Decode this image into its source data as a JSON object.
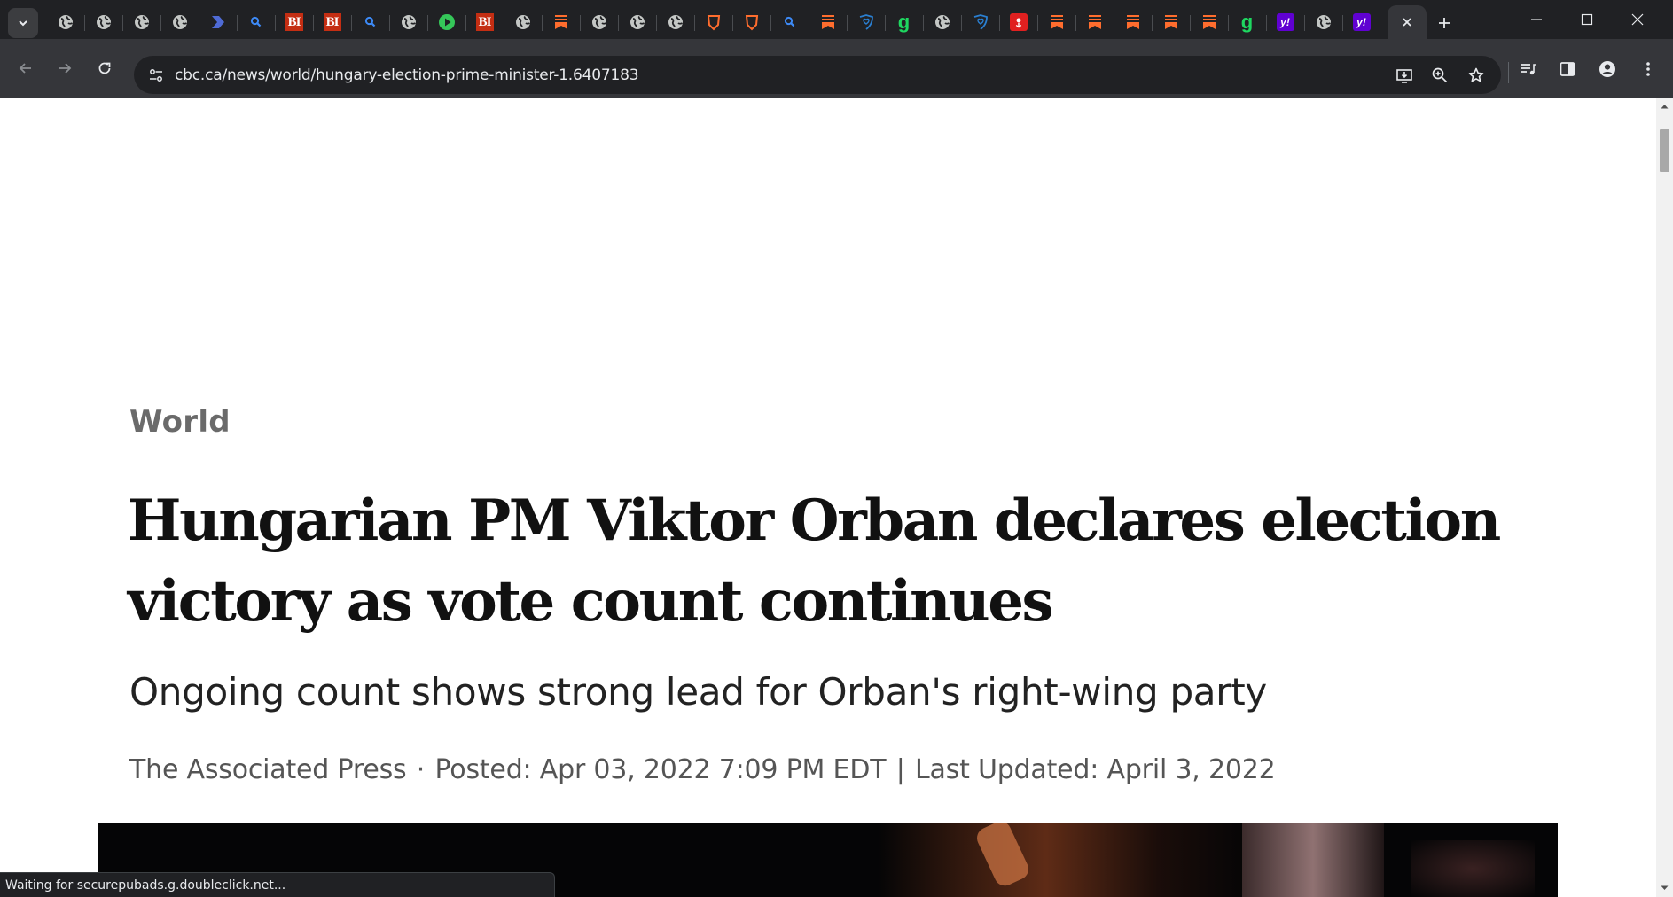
{
  "tabs": [
    {
      "icon": "globe-icon"
    },
    {
      "icon": "globe-icon"
    },
    {
      "icon": "globe-icon"
    },
    {
      "icon": "globe-icon"
    },
    {
      "icon": "blue-arrow-icon"
    },
    {
      "icon": "magnifier-icon"
    },
    {
      "icon": "business-insider-icon",
      "label": "BI"
    },
    {
      "icon": "business-insider-icon",
      "label": "BI"
    },
    {
      "icon": "magnifier-icon"
    },
    {
      "icon": "globe-icon"
    },
    {
      "icon": "play-icon"
    },
    {
      "icon": "business-insider-icon",
      "label": "BI"
    },
    {
      "icon": "globe-icon"
    },
    {
      "icon": "bookmark-ribbon-icon"
    },
    {
      "icon": "globe-icon"
    },
    {
      "icon": "globe-icon"
    },
    {
      "icon": "globe-icon"
    },
    {
      "icon": "brave-shield-icon"
    },
    {
      "icon": "brave-shield-icon"
    },
    {
      "icon": "magnifier-icon"
    },
    {
      "icon": "bookmark-ribbon-icon"
    },
    {
      "icon": "heart-shield-icon"
    },
    {
      "icon": "grammarly-icon",
      "label": "g"
    },
    {
      "icon": "globe-icon"
    },
    {
      "icon": "heart-shield-icon"
    },
    {
      "icon": "red-badge-icon"
    },
    {
      "icon": "bookmark-ribbon-icon"
    },
    {
      "icon": "bookmark-ribbon-icon"
    },
    {
      "icon": "bookmark-ribbon-icon"
    },
    {
      "icon": "bookmark-ribbon-icon"
    },
    {
      "icon": "bookmark-ribbon-icon"
    },
    {
      "icon": "grammarly-icon",
      "label": "g"
    },
    {
      "icon": "yahoo-icon",
      "label": "y!"
    },
    {
      "icon": "globe-icon"
    },
    {
      "icon": "yahoo-icon",
      "label": "y!"
    }
  ],
  "toolbar": {
    "url": "cbc.ca/news/world/hungary-election-prime-minister-1.6407183"
  },
  "article": {
    "category": "World",
    "headline_line1": "Hungarian PM Viktor Orban declares election",
    "headline_line2": "victory as vote count continues",
    "deck": "Ongoing count shows strong lead for Orban's right-wing party",
    "author": "The Associated Press",
    "byline_dot": "·",
    "posted": "Posted: Apr 03, 2022 7:09 PM EDT",
    "byline_bar": "|",
    "updated": "Last Updated: April 3, 2022"
  },
  "status_text": "Waiting for securepubads.g.doubleclick.net...",
  "colors": {
    "tabstrip_bg": "#202124",
    "toolbar_bg": "#35363a",
    "bi_red": "#c42e13",
    "bookmark_orange": "#ff6d2e",
    "grammarly_green": "#1ed760",
    "yahoo_purple": "#6001d2"
  }
}
